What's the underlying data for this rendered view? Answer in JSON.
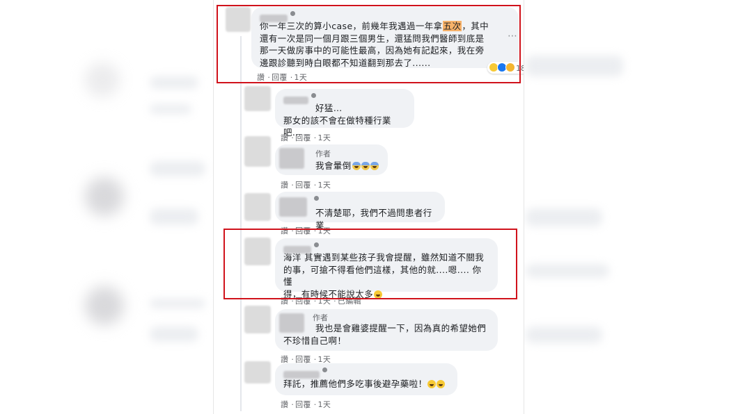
{
  "colors": {
    "highlight_box": "#d0121b",
    "bubble_bg": "#f0f2f5",
    "highlight_word_bg": "#f7b26a",
    "meta_text": "#65676b"
  },
  "comments": [
    {
      "lines": [
        "你一年三次的算小case，前幾年我遇過一年拿",
        "還有一次是同一個月跟三個男生，還猛問我們醫師到底是",
        "那一天做房事中的可能性最高，因為她有記起來，我在旁",
        "邊跟診聽到時白眼都不知道翻到那去了......"
      ],
      "highlight_word": "五次",
      "line1_tail": "，其中",
      "actions": [
        "讚",
        "回覆",
        "1天"
      ],
      "reaction_count": "18",
      "reaction_icons": [
        "wow-reaction-icon",
        "like-reaction-icon",
        "haha-reaction-icon"
      ]
    },
    {
      "lines": [
        "好猛…",
        "那女的該不會在做特種行業吧..."
      ],
      "actions": [
        "讚",
        "回覆",
        "1天"
      ]
    },
    {
      "author_tag": "作者",
      "lines": [
        "我會暈倒"
      ],
      "emoji": [
        "scared-face-icon",
        "scared-face-icon",
        "scared-face-icon"
      ],
      "actions": [
        "讚",
        "回覆",
        "1天"
      ]
    },
    {
      "lines": [
        "不清楚耶，我們不過問患者行業"
      ],
      "actions": [
        "讚",
        "回覆",
        "1天"
      ]
    },
    {
      "lines": [
        "海洋 其實遇到某些孩子我會提醒，雖然知道不關我",
        "的事，可搶不得看他們這樣，其他的就....嗯.... 你懂",
        "得，有時候不能說太多"
      ],
      "emoji": [
        "grin-face-icon"
      ],
      "actions": [
        "讚",
        "回覆",
        "1天",
        "已編輯"
      ]
    },
    {
      "author_tag": "作者",
      "lines": [
        "我也是會雞婆提醒一下，因為真的希望她們",
        "不珍惜自己啊！"
      ],
      "actions": [
        "讚",
        "回覆",
        "1天"
      ]
    },
    {
      "lines": [
        "拜託，推薦他們多吃事後避孕藥啦！"
      ],
      "emoji": [
        "grin-face-icon",
        "grin-face-icon"
      ],
      "actions": [
        "讚",
        "回覆",
        "1天"
      ]
    }
  ]
}
